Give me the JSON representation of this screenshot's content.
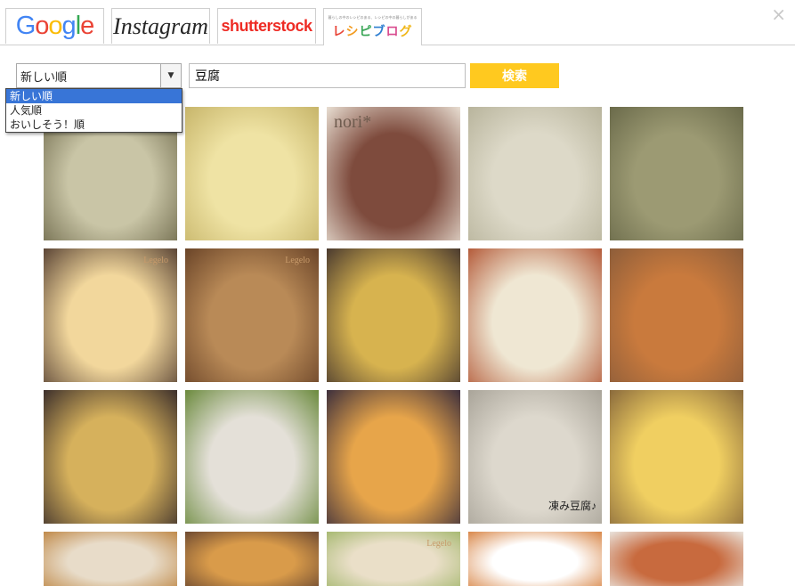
{
  "tabs": {
    "google": "Google",
    "instagram": "Instagram",
    "shutterstock": "shutterstock",
    "recipe_blog_tagline": "暮らしの中のレシピのある、レシピの中の暮らしがある",
    "recipe_blog": "レシピブログ"
  },
  "close": "×",
  "sort": {
    "selected": "新しい順",
    "options": [
      "新しい順",
      "人気順",
      "おいしそう！順"
    ]
  },
  "search": {
    "value": "豆腐"
  },
  "search_button": "検索",
  "colors": {
    "search_button": "#ffc91f",
    "dropdown_highlight": "#3875d7",
    "google_blue": "#4285f4",
    "google_red": "#ea4335",
    "google_yellow": "#fbbc05",
    "google_green": "#34a853",
    "shutterstock_red": "#ee2b24"
  },
  "thumbnails": [
    {
      "subject": "tofu and mushroom soup"
    },
    {
      "subject": "creamy yellow sauce"
    },
    {
      "subject": "tiramisu in glasses",
      "overlay": "nori*"
    },
    {
      "subject": "white tofu cream"
    },
    {
      "subject": "green tofu paste"
    },
    {
      "subject": "tofu omelette",
      "overlay": "Legelo"
    },
    {
      "subject": "tofu croquettes",
      "overlay": "Legelo"
    },
    {
      "subject": "simmered tofu in bowl"
    },
    {
      "subject": "agedashi tofu"
    },
    {
      "subject": "mapo tofu"
    },
    {
      "subject": "tofu gratin cups"
    },
    {
      "subject": "tofu rice plate"
    },
    {
      "subject": "fried tofu balls"
    },
    {
      "subject": "frozen tofu",
      "overlay": "凍み豆腐♪"
    },
    {
      "subject": "tofu rice bowl"
    },
    {
      "subject": "dish partially visible"
    },
    {
      "subject": "fried tofu"
    },
    {
      "subject": "tofu with cabbage",
      "overlay": "Legelo"
    },
    {
      "subject": "dish partially visible"
    },
    {
      "subject": "tofu in sauce"
    }
  ]
}
